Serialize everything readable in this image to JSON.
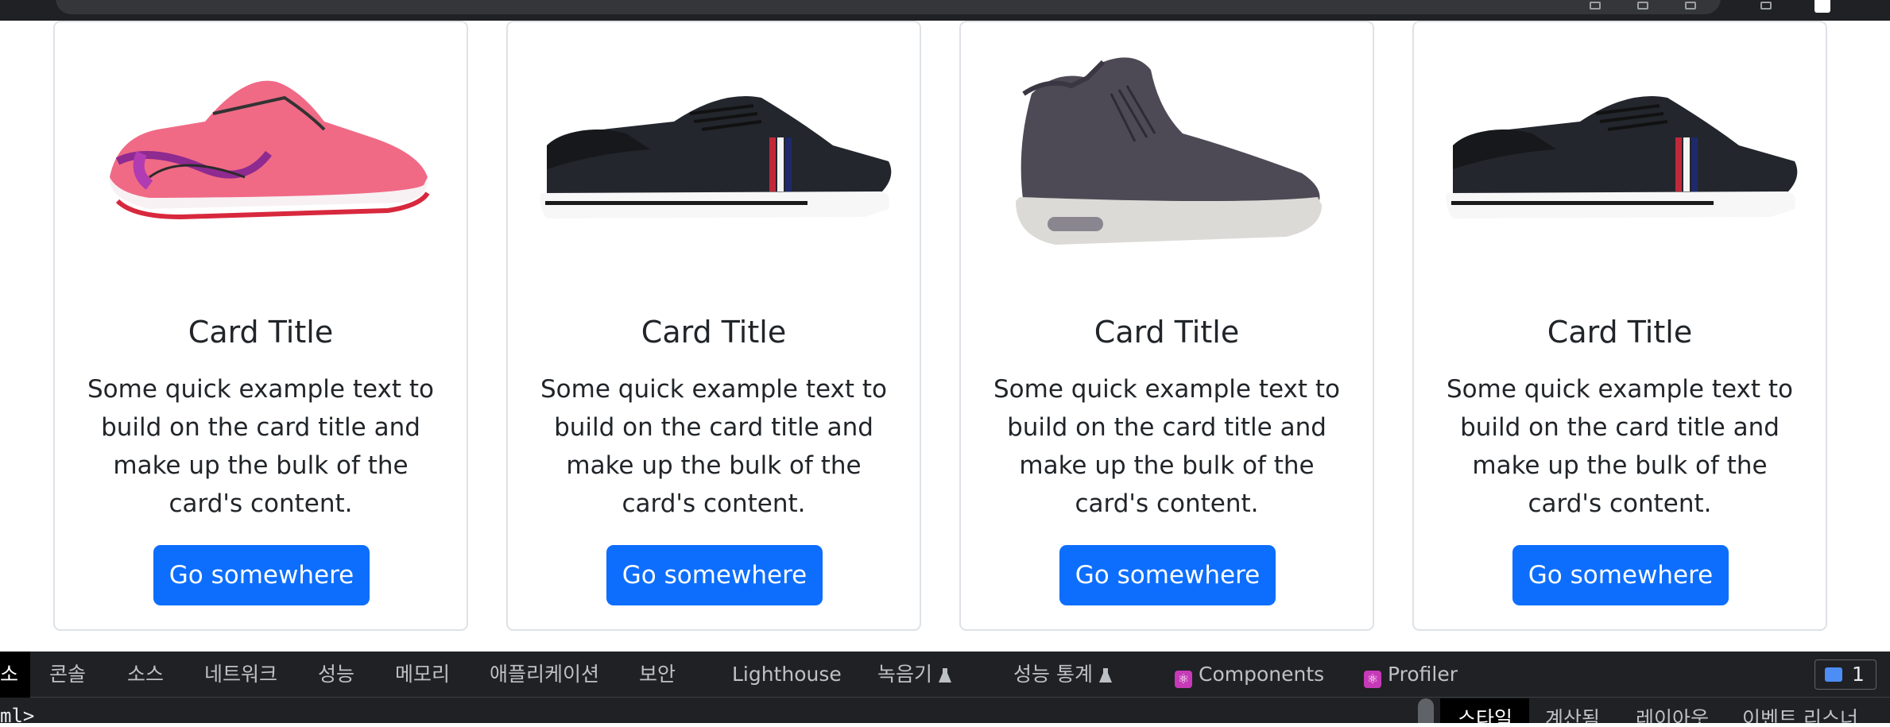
{
  "cards": [
    {
      "image": "pink-running-shoe",
      "title": "Card Title",
      "text": "Some quick example text to build on the card title and make up the bulk of the card's content.",
      "button": "Go somewhere"
    },
    {
      "image": "black-low-top-sneaker",
      "title": "Card Title",
      "text": "Some quick example text to build on the card title and make up the bulk of the card's content.",
      "button": "Go somewhere"
    },
    {
      "image": "gray-high-top-sneaker",
      "title": "Card Title",
      "text": "Some quick example text to build on the card title and make up the bulk of the card's content.",
      "button": "Go somewhere"
    },
    {
      "image": "black-low-top-sneaker",
      "title": "Card Title",
      "text": "Some quick example text to build on the card title and make up the bulk of the card's content.",
      "button": "Go somewhere"
    }
  ],
  "devtools": {
    "tabs": [
      {
        "label": "소",
        "active": true
      },
      {
        "label": "콘솔"
      },
      {
        "label": "소스"
      },
      {
        "label": "네트워크"
      },
      {
        "label": "성능"
      },
      {
        "label": "메모리"
      },
      {
        "label": "애플리케이션"
      },
      {
        "label": "보안"
      },
      {
        "label": "Lighthouse"
      },
      {
        "label": "녹음기",
        "icon": "flask-icon"
      },
      {
        "label": "성능 통계",
        "icon": "flask-icon"
      },
      {
        "label": "Components",
        "icon": "react-icon"
      },
      {
        "label": "Profiler",
        "icon": "react-icon"
      }
    ],
    "issues_count": "1",
    "code_fragment": "ml>",
    "side_tabs": [
      {
        "label": "스타일",
        "active": true
      },
      {
        "label": "계산됨"
      },
      {
        "label": "레이아웃"
      },
      {
        "label": "이벤트 리스너"
      }
    ]
  },
  "colors": {
    "button": "#0d6efd",
    "card_border": "#dee2e6",
    "devtools_bg": "#202124"
  }
}
